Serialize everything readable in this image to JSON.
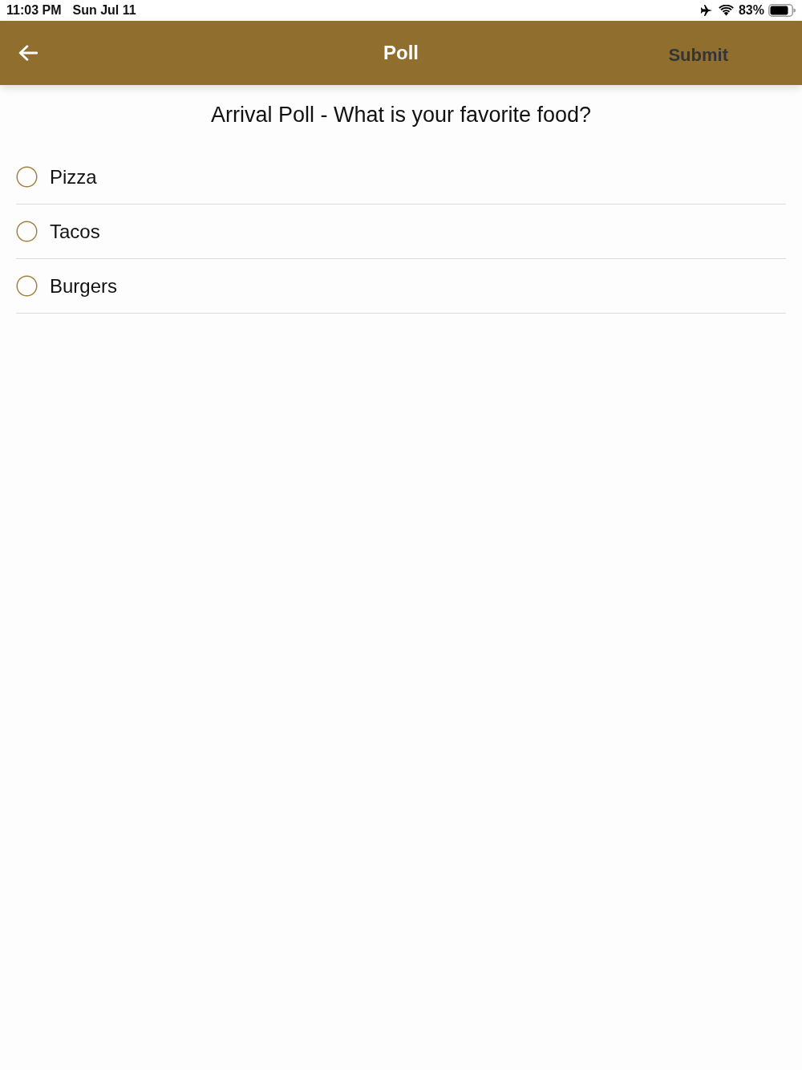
{
  "status_bar": {
    "time": "11:03 PM",
    "date": "Sun Jul 11",
    "battery": "83%"
  },
  "header": {
    "title": "Poll",
    "submit": {
      "label": "Submit",
      "disabled": true
    }
  },
  "question": "Arrival Poll - What is your favorite food?",
  "options": [
    {
      "label": "Pizza",
      "selected": false
    },
    {
      "label": "Tacos",
      "selected": false
    },
    {
      "label": "Burgers",
      "selected": false
    }
  ]
}
